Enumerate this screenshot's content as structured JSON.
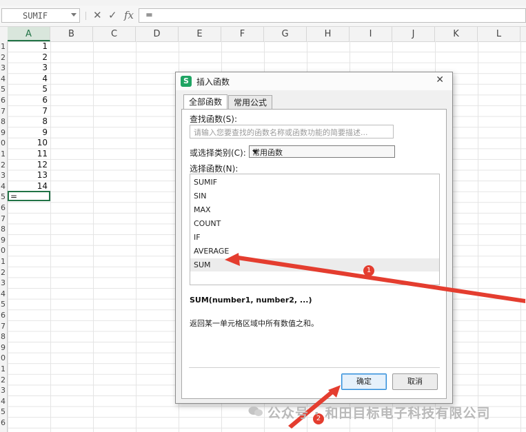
{
  "formula_bar": {
    "name_box": "SUMIF",
    "cancel_icon": "✕",
    "confirm_icon": "✓",
    "fx_label": "fx",
    "formula": "="
  },
  "columns": [
    "A",
    "B",
    "C",
    "D",
    "E",
    "F",
    "G",
    "H",
    "I",
    "J",
    "K",
    "L"
  ],
  "selected_column": "A",
  "row_numbers": [
    "1",
    "2",
    "3",
    "4",
    "5",
    "6",
    "7",
    "8",
    "9",
    "0",
    "1",
    "2",
    "3",
    "4",
    "5",
    "6",
    "7",
    "8",
    "9",
    "0",
    "1",
    "2",
    "3",
    "4",
    "5",
    "6",
    "7",
    "8",
    "9",
    "0",
    "1",
    "2",
    "3",
    "4",
    "5",
    "6"
  ],
  "column_a_values": [
    "1",
    "2",
    "3",
    "4",
    "5",
    "6",
    "7",
    "8",
    "9",
    "10",
    "11",
    "12",
    "13",
    "14"
  ],
  "active_cell_value": "=",
  "dialog": {
    "title": "插入函数",
    "close_icon": "✕",
    "tabs": [
      "全部函数",
      "常用公式"
    ],
    "search_label": "查找函数(S):",
    "search_placeholder": "请输入您要查找的函数名称或函数功能的简要描述...",
    "category_label": "或选择类别(C):",
    "category_value": "常用函数",
    "function_list_label": "选择函数(N):",
    "functions": [
      "SUMIF",
      "SIN",
      "MAX",
      "COUNT",
      "IF",
      "AVERAGE",
      "SUM"
    ],
    "selected_function": "SUM",
    "signature": "SUM(number1, number2, ...)",
    "description": "返回某一单元格区域中所有数值之和。",
    "ok_label": "确定",
    "cancel_label": "取消"
  },
  "annotations": {
    "badge_1": "1",
    "badge_2": "2",
    "color": "#e43d2f"
  },
  "watermark": "公众号 · 和田目标电子科技有限公司"
}
